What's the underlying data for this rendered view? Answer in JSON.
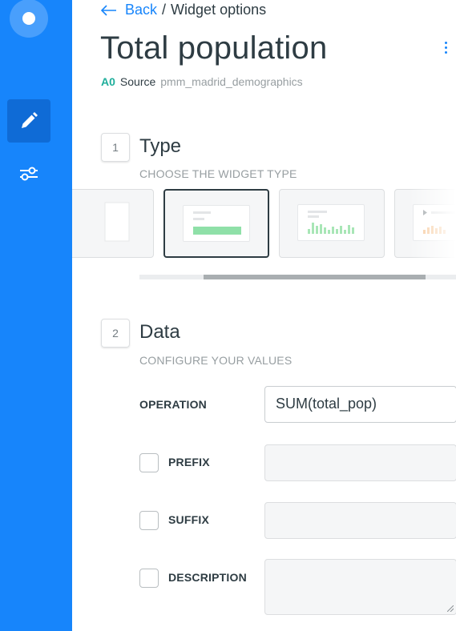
{
  "nav": {
    "back_label": "Back",
    "separator": "/",
    "current": "Widget options"
  },
  "page": {
    "title": "Total population"
  },
  "source": {
    "badge": "A0",
    "label": "Source",
    "name": "pmm_madrid_demographics"
  },
  "sections": [
    {
      "number": "1",
      "title": "Type",
      "subtitle": "CHOOSE THE WIDGET TYPE"
    },
    {
      "number": "2",
      "title": "Data",
      "subtitle": "CONFIGURE YOUR VALUES"
    }
  ],
  "widget_types": [
    {
      "icon": "category-widget-icon"
    },
    {
      "icon": "formula-widget-icon",
      "selected": true
    },
    {
      "icon": "histogram-widget-icon"
    },
    {
      "icon": "time-series-widget-icon"
    }
  ],
  "fields": {
    "operation": {
      "label": "OPERATION",
      "value": "SUM(total_pop)"
    },
    "prefix": {
      "label": "PREFIX",
      "value": ""
    },
    "suffix": {
      "label": "SUFFIX",
      "value": ""
    },
    "description": {
      "label": "DESCRIPTION",
      "value": ""
    }
  },
  "colors": {
    "sidebar": "#1785fb",
    "accent": "#1785fb",
    "source_badge": "#1fae9b",
    "formula_bar": "#8fe0a8",
    "histogram_bar": "#a8e6b6",
    "time_series_bar": "#f6c797"
  }
}
